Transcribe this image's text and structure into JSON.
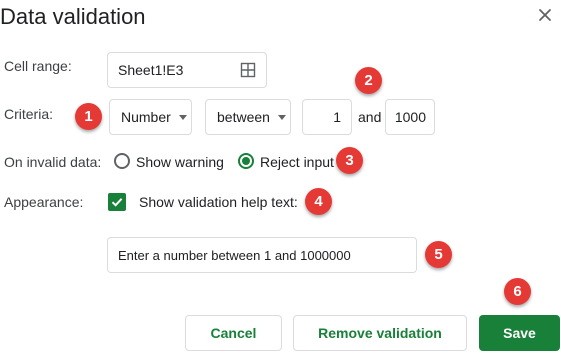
{
  "dialog": {
    "title": "Data validation",
    "close_icon": "close-icon"
  },
  "cell_range": {
    "label": "Cell range:",
    "value": "Sheet1!E3",
    "icon": "grid-icon"
  },
  "criteria": {
    "label": "Criteria:",
    "type_value": "Number",
    "condition_value": "between",
    "min_value": "1",
    "and_label": "and",
    "max_value": "1000"
  },
  "invalid_data": {
    "label": "On invalid data:",
    "options": [
      {
        "label": "Show warning",
        "selected": false
      },
      {
        "label": "Reject input",
        "selected": true
      }
    ]
  },
  "appearance": {
    "label": "Appearance:",
    "checkbox_label": "Show validation help text:",
    "checked": true,
    "help_text": "Enter a number between 1 and 1000000"
  },
  "buttons": {
    "cancel": "Cancel",
    "remove": "Remove validation",
    "save": "Save"
  },
  "badges": [
    "1",
    "2",
    "3",
    "4",
    "5",
    "6"
  ],
  "colors": {
    "accent": "#188038",
    "badge": "#e53935",
    "border": "#dadce0"
  }
}
